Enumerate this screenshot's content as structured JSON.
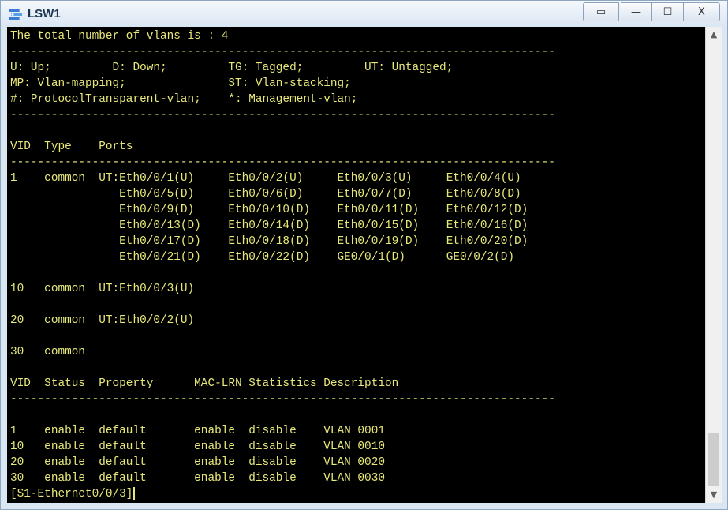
{
  "window": {
    "title": "LSW1",
    "controls": {
      "restore": "▭",
      "minimize": "—",
      "maximize": "☐",
      "close": "X"
    }
  },
  "terminal": {
    "lines": [
      "The total number of vlans is : 4",
      "--------------------------------------------------------------------------------",
      "U: Up;         D: Down;         TG: Tagged;         UT: Untagged;",
      "MP: Vlan-mapping;               ST: Vlan-stacking;",
      "#: ProtocolTransparent-vlan;    *: Management-vlan;",
      "--------------------------------------------------------------------------------",
      "",
      "VID  Type    Ports",
      "--------------------------------------------------------------------------------",
      "1    common  UT:Eth0/0/1(U)     Eth0/0/2(U)     Eth0/0/3(U)     Eth0/0/4(U)",
      "                Eth0/0/5(D)     Eth0/0/6(D)     Eth0/0/7(D)     Eth0/0/8(D)",
      "                Eth0/0/9(D)     Eth0/0/10(D)    Eth0/0/11(D)    Eth0/0/12(D)",
      "                Eth0/0/13(D)    Eth0/0/14(D)    Eth0/0/15(D)    Eth0/0/16(D)",
      "                Eth0/0/17(D)    Eth0/0/18(D)    Eth0/0/19(D)    Eth0/0/20(D)",
      "                Eth0/0/21(D)    Eth0/0/22(D)    GE0/0/1(D)      GE0/0/2(D)",
      "",
      "10   common  UT:Eth0/0/3(U)",
      "",
      "20   common  UT:Eth0/0/2(U)",
      "",
      "30   common",
      "",
      "VID  Status  Property      MAC-LRN Statistics Description",
      "--------------------------------------------------------------------------------",
      "",
      "1    enable  default       enable  disable    VLAN 0001",
      "10   enable  default       enable  disable    VLAN 0010",
      "20   enable  default       enable  disable    VLAN 0020",
      "30   enable  default       enable  disable    VLAN 0030"
    ],
    "prompt": "[S1-Ethernet0/0/3]"
  },
  "scrollbar": {
    "up_arrow": "▲",
    "down_arrow": "▼"
  },
  "colors": {
    "terminal_bg": "#000000",
    "terminal_fg": "#e8e87a",
    "title_text": "#1e3550"
  }
}
